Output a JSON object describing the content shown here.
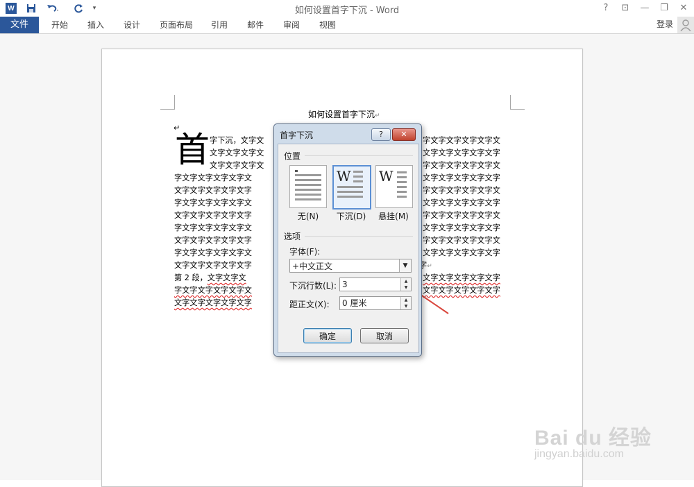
{
  "window": {
    "title": "如何设置首字下沉 - Word",
    "logo": "W",
    "controls": [
      "?",
      "⊡",
      "—",
      "❐",
      "✕"
    ]
  },
  "ribbon": {
    "file_tab": "文件",
    "tabs": [
      "开始",
      "插入",
      "设计",
      "页面布局",
      "引用",
      "邮件",
      "审阅",
      "视图"
    ],
    "signin": "登录"
  },
  "document": {
    "title": "如何设置首字下沉",
    "drop_cap": "首",
    "lines": [
      "字下沉，文字文",
      "文字文字文字文",
      "文字文字文字文",
      "字文字文字文字文字文",
      "文字文字文字文字文字",
      "字文字文字文字文字文",
      "文字文字文字文字文字",
      "字文字文字文字文字文",
      "文字文字文字文字文字",
      "字文字文字文字文字文",
      "文字文字文字文字文字"
    ],
    "right_lines": [
      "字文字文字文字文字文",
      "文字文字文字文字文字",
      "字文字文字文字文字文",
      "文字文字文字文字文字",
      "字文字文字文字文字文",
      "文字文字文字文字文字",
      "字文字文字文字文字文",
      "文字文字文字文字文字",
      "字文字文字文字文字文",
      "文字文字文字文字文字",
      "字文字文字文字文字文"
    ],
    "para1_end": "字",
    "para2": {
      "label": "第 2 段，",
      "line1": "文字文字文",
      "line2": "字文字文字文字文字文",
      "line3": "文字文字文字文字文字",
      "right1": "文字文字文字文字文字",
      "right2": "文字文字文字文字文字"
    }
  },
  "dialog": {
    "title": "首字下沉",
    "help": "?",
    "close": "✕",
    "position_group": "位置",
    "positions": [
      {
        "label": "无(N)"
      },
      {
        "label": "下沉(D)",
        "selected": true
      },
      {
        "label": "悬挂(M)"
      }
    ],
    "options_group": "选项",
    "font_label": "字体(F):",
    "font_value": "+中文正文",
    "lines_label": "下沉行数(L):",
    "lines_value": "3",
    "distance_label": "距正文(X):",
    "distance_value": "0 厘米",
    "ok": "确定",
    "cancel": "取消"
  },
  "watermark": {
    "main": "Bai du 经验",
    "sub": "jingyan.baidu.com"
  }
}
